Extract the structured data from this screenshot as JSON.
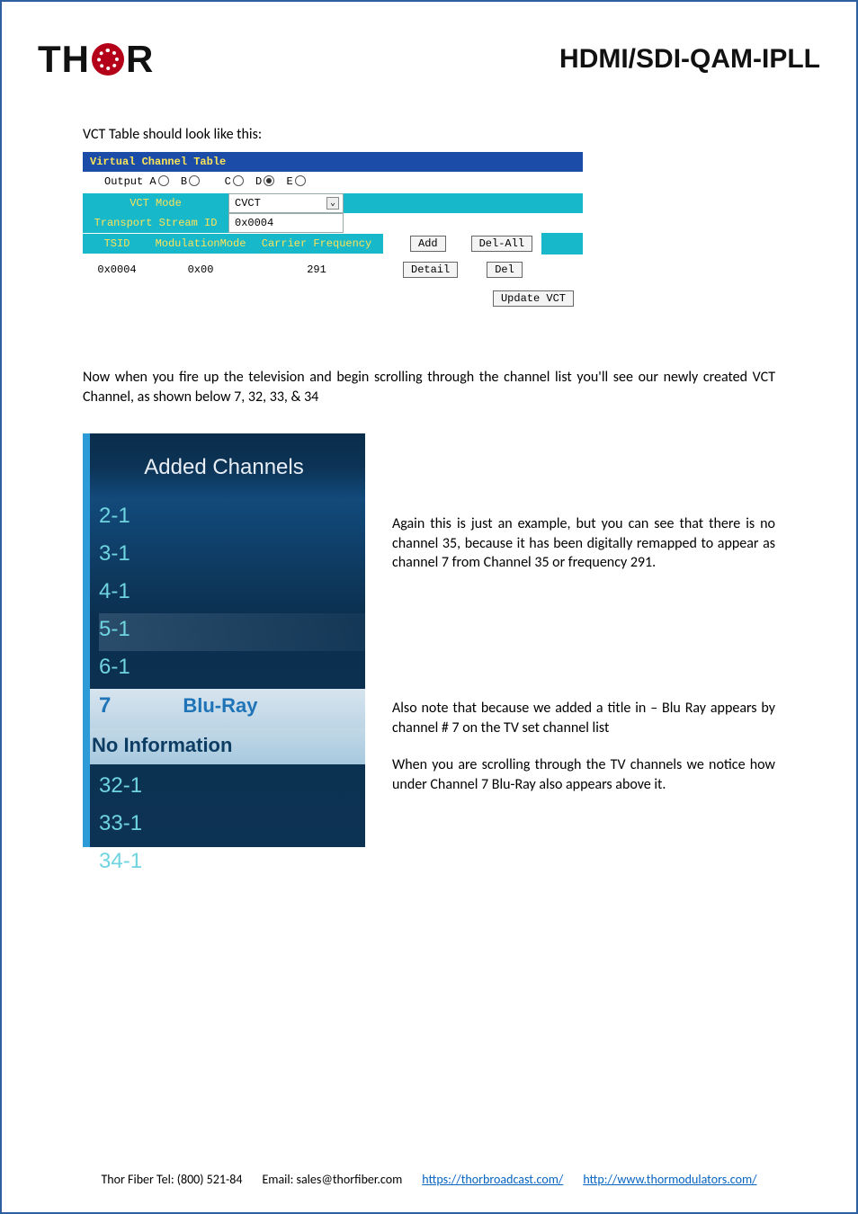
{
  "header": {
    "logo_left": "TH",
    "logo_right": "R",
    "title": "HDMI/SDI-QAM-IPLL"
  },
  "body": {
    "intro": "VCT Table should look like this:",
    "para1": "Now when you fire up the television and begin scrolling through the channel list you'll see our newly created VCT Channel, as shown below 7, 32, 33, & 34",
    "para2": "Again this is just an example, but you can see that there is no channel 35, because it has been digitally remapped to appear as channel 7 from Channel 35 or frequency 291.",
    "para3": "Also note that because we added a title in – Blu Ray appears by channel # 7 on the TV set channel list",
    "para4": "When you are scrolling through the TV channels we notice how under Channel 7 Blu-Ray also appears above it."
  },
  "vct": {
    "title": "Virtual Channel Table",
    "output_label": "Output",
    "outputs": [
      "A",
      "B",
      "C",
      "D",
      "E"
    ],
    "output_selected": "D",
    "mode_label": "VCT Mode",
    "mode_value": "CVCT",
    "tsid_label": "Transport Stream ID",
    "tsid_value": "0x0004",
    "cols": [
      "TSID",
      "ModulationMode",
      "Carrier Frequency"
    ],
    "row": {
      "tsid": "0x0004",
      "mod": "0x00",
      "freq": "291"
    },
    "buttons": {
      "add": "Add",
      "del_all": "Del-All",
      "detail": "Detail",
      "del": "Del",
      "update": "Update VCT"
    }
  },
  "tv": {
    "title": "Added Channels",
    "channels": [
      "2-1",
      "3-1",
      "4-1",
      "5-1",
      "6-1",
      "32-1",
      "33-1",
      "34-1"
    ],
    "selected": {
      "num": "7",
      "label": "Blu-Ray"
    },
    "no_info": "No Information"
  },
  "footer": {
    "phone": "Thor Fiber Tel: (800) 521-84",
    "email": "Email: sales@thorfiber.com",
    "link1": "https://thorbroadcast.com/",
    "link2": "http://www.thormodulators.com/"
  }
}
